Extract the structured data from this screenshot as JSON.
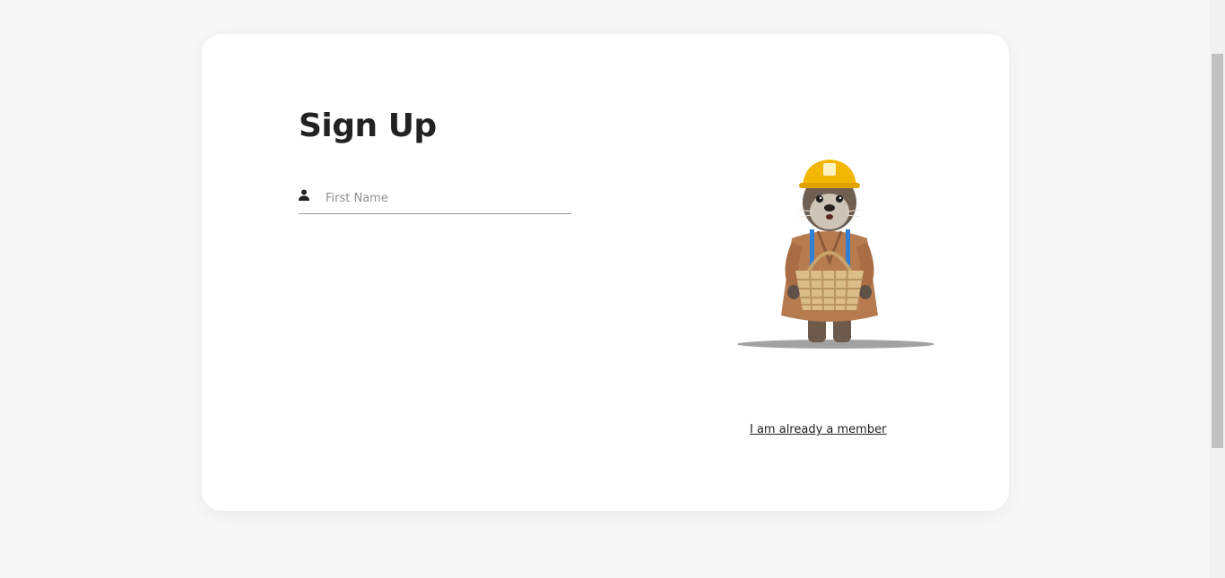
{
  "signup": {
    "title": "Sign Up",
    "first_name": {
      "value": "",
      "placeholder": "First Name",
      "icon": "person-icon"
    },
    "illustration": "beaver-mascot-illustration",
    "member_link": "I am already a member"
  },
  "colors": {
    "background": "#f7f7f7",
    "card": "#ffffff",
    "text": "#222222",
    "helmet": "#f2b705",
    "suspenders": "#2f7fd6",
    "coat": "#b77b50"
  }
}
